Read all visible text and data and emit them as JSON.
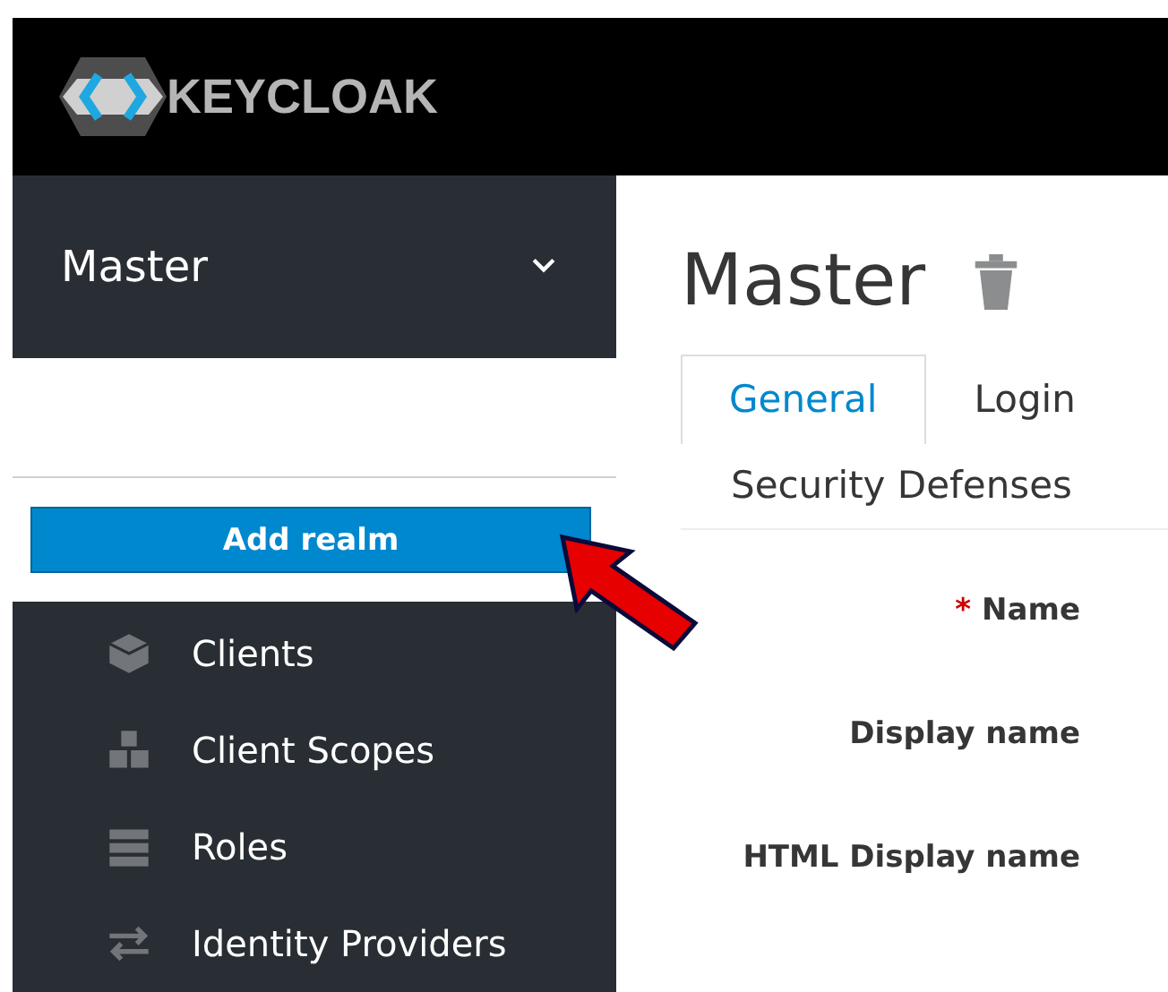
{
  "header": {
    "logo_text": "KEYCLOAK"
  },
  "sidebar": {
    "realm": "Master",
    "add_realm_button": "Add realm",
    "items": [
      {
        "label": "Clients"
      },
      {
        "label": "Client Scopes"
      },
      {
        "label": "Roles"
      },
      {
        "label": "Identity Providers"
      }
    ]
  },
  "main": {
    "title": "Master",
    "tabs": [
      {
        "label": "General",
        "selected": true
      },
      {
        "label": "Login",
        "selected": false
      },
      {
        "label": "Security Defenses",
        "selected": false
      }
    ],
    "fields": [
      {
        "label": "Name",
        "required_mark": "*"
      },
      {
        "label": "Display name"
      },
      {
        "label": "HTML Display name"
      }
    ]
  }
}
